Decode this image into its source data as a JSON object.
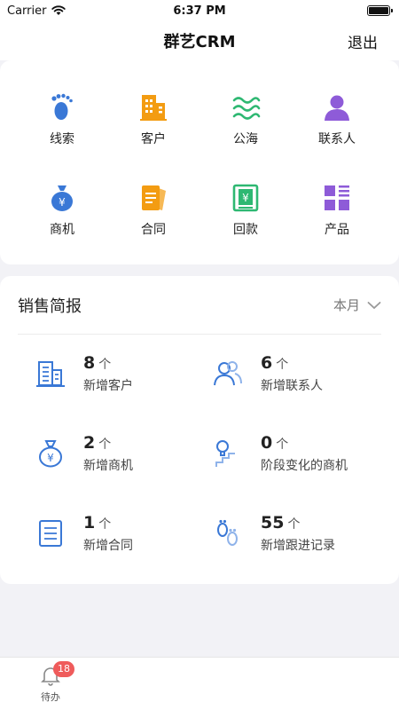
{
  "status_bar": {
    "carrier": "Carrier",
    "time": "6:37 PM"
  },
  "nav": {
    "title": "群艺CRM",
    "logout_label": "退出"
  },
  "modules": [
    {
      "label": "线索",
      "icon": "footprint-icon",
      "color": "#3a78d6"
    },
    {
      "label": "客户",
      "icon": "building-icon",
      "color": "#f39c12"
    },
    {
      "label": "公海",
      "icon": "waves-icon",
      "color": "#2eb872"
    },
    {
      "label": "联系人",
      "icon": "person-icon",
      "color": "#8e5bd8"
    },
    {
      "label": "商机",
      "icon": "money-bag-icon",
      "color": "#3a78d6"
    },
    {
      "label": "合同",
      "icon": "contract-icon",
      "color": "#f39c12"
    },
    {
      "label": "回款",
      "icon": "payment-return-icon",
      "color": "#2eb872"
    },
    {
      "label": "产品",
      "icon": "product-grid-icon",
      "color": "#8e5bd8"
    }
  ],
  "report": {
    "title": "销售简报",
    "period": "本月",
    "stats": [
      {
        "value": "8",
        "unit": "个",
        "label": "新增客户",
        "icon": "building-outline-icon"
      },
      {
        "value": "6",
        "unit": "个",
        "label": "新增联系人",
        "icon": "people-icon"
      },
      {
        "value": "2",
        "unit": "个",
        "label": "新增商机",
        "icon": "money-bag-outline-icon"
      },
      {
        "value": "0",
        "unit": "个",
        "label": "阶段变化的商机",
        "icon": "stairs-bulb-icon"
      },
      {
        "value": "1",
        "unit": "个",
        "label": "新增合同",
        "icon": "document-icon"
      },
      {
        "value": "55",
        "unit": "个",
        "label": "新增跟进记录",
        "icon": "footprint-outline-icon"
      }
    ]
  },
  "tab_bar": {
    "todo_label": "待办",
    "todo_badge": "18"
  },
  "colors": {
    "accent": "#3a78d6",
    "badge": "#ef5b5b",
    "background": "#f2f2f6"
  }
}
